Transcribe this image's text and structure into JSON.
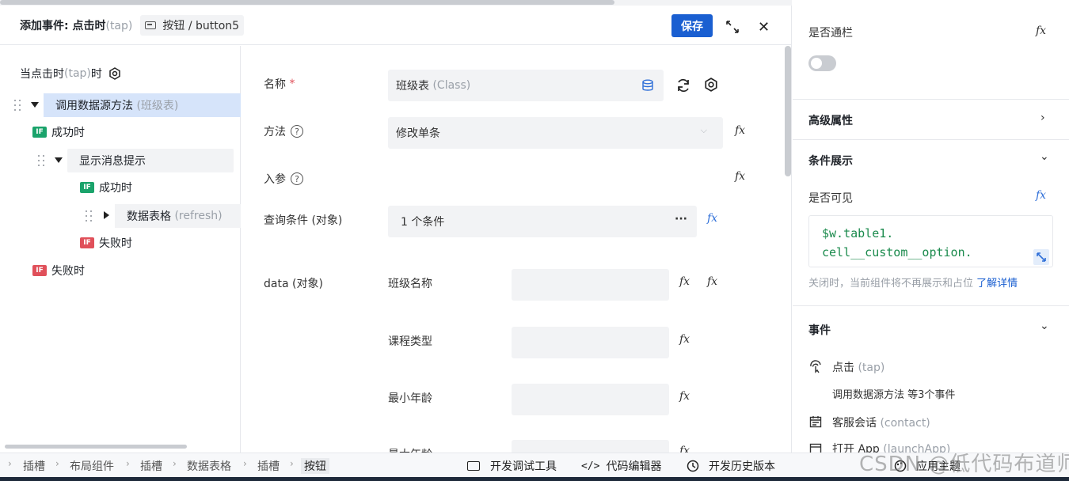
{
  "header": {
    "title": "添加事件: 点击时",
    "title_suffix": "(tap)",
    "tag": "按钮 / button5",
    "save": "保存"
  },
  "tree": {
    "root_label": "当点击时",
    "root_suffix": "(tap)",
    "root_after": "时",
    "items": [
      {
        "label": "调用数据源方法",
        "suffix": "(班级表)"
      },
      {
        "label": "成功时",
        "badge": "IF"
      },
      {
        "label": "显示消息提示"
      },
      {
        "label": "成功时",
        "badge": "IF"
      },
      {
        "label": "数据表格",
        "suffix": "(refresh)"
      },
      {
        "label": "失败时",
        "badge": "IF"
      },
      {
        "label": "失败时",
        "badge": "IF"
      }
    ]
  },
  "form": {
    "name_label": "名称",
    "required": "*",
    "name_value": "班级表",
    "name_value_suffix": "(Class)",
    "method_label": "方法",
    "method_value": "修改单条",
    "params_label": "入参",
    "query_label": "查询条件 (对象)",
    "query_value": "1 个条件",
    "query_more": "···",
    "data_label": "data (对象)",
    "fields": [
      "班级名称",
      "课程类型",
      "最小年龄",
      "最大年龄"
    ],
    "help": "?",
    "fx": "fx"
  },
  "right": {
    "banner_label": "是否通栏",
    "advanced": "高级属性",
    "condition_title": "条件展示",
    "visible_label": "是否可见",
    "code": [
      "$w.table1.",
      "cell__custom__option."
    ],
    "hint": "关闭时，当前组件将不再展示和占位",
    "hint_link": "了解详情",
    "events_title": "事件",
    "events": [
      {
        "name": "点击",
        "suffix": "(tap)",
        "detail": "调用数据源方法 等3个事件"
      },
      {
        "name": "客服会话",
        "suffix": "(contact)"
      },
      {
        "name": "打开 App",
        "suffix": "(launchApp)"
      }
    ]
  },
  "bottom": {
    "breadcrumbs": [
      "插槽",
      "布局组件",
      "插槽",
      "数据表格",
      "插槽",
      "按钮"
    ],
    "tools": [
      "开发调试工具",
      "代码编辑器",
      "开发历史版本",
      "应用主题"
    ]
  },
  "watermark": "CSDN @低代码布道师",
  "colors": {
    "primary": "#1a5fd1",
    "success": "#1aa36b",
    "danger": "#e0505a",
    "code": "#1a8a4c",
    "link": "#1a5fd1"
  }
}
